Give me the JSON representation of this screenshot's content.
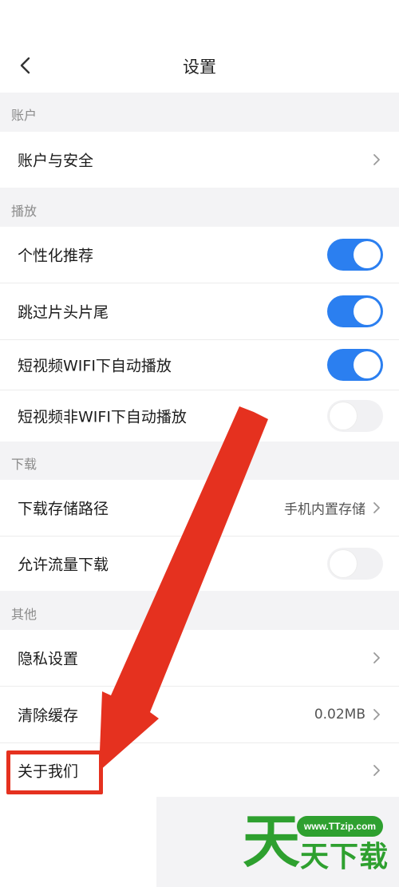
{
  "header": {
    "title": "设置"
  },
  "sections": {
    "account": {
      "title": "账户",
      "items": [
        {
          "label": "账户与安全"
        }
      ]
    },
    "playback": {
      "title": "播放",
      "items": [
        {
          "label": "个性化推荐",
          "toggle": true
        },
        {
          "label": "跳过片头片尾",
          "toggle": true
        },
        {
          "label": "短视频WIFI下自动播放",
          "toggle": true
        },
        {
          "label": "短视频非WIFI下自动播放",
          "toggle": false
        }
      ]
    },
    "download": {
      "title": "下载",
      "items": [
        {
          "label": "下载存储路径",
          "value": "手机内置存储"
        },
        {
          "label": "允许流量下载",
          "toggle": false
        }
      ]
    },
    "other": {
      "title": "其他",
      "items": [
        {
          "label": "隐私设置"
        },
        {
          "label": "清除缓存",
          "value": "0.02MB"
        },
        {
          "label": "关于我们"
        }
      ]
    }
  },
  "watermark": {
    "url": "www.TTzip.com",
    "big_char": "天",
    "small_text": "天下载"
  },
  "colors": {
    "toggle_on": "#2b7ff0",
    "annotation": "#e5311f",
    "watermark": "#2ea02f"
  }
}
